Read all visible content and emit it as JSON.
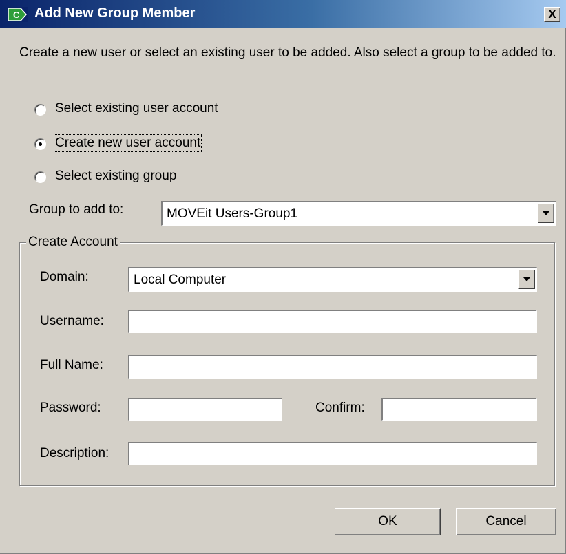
{
  "window": {
    "title": "Add New Group Member",
    "close_label": "X",
    "icon": "app-logo-icon"
  },
  "instruction": "Create a new user or select an existing user to be added. Also select a group to be added to.",
  "options": [
    {
      "label": "Select existing user account",
      "selected": false
    },
    {
      "label": "Create new user account",
      "selected": true
    },
    {
      "label": "Select existing group",
      "selected": false
    }
  ],
  "group_to_add": {
    "label": "Group to add to:",
    "value": "MOVEit Users-Group1"
  },
  "create_account": {
    "legend": "Create Account",
    "domain": {
      "label": "Domain:",
      "value": "Local Computer"
    },
    "username": {
      "label": "Username:",
      "value": ""
    },
    "full_name": {
      "label": "Full Name:",
      "value": ""
    },
    "password": {
      "label": "Password:",
      "value": ""
    },
    "confirm": {
      "label": "Confirm:",
      "value": ""
    },
    "description": {
      "label": "Description:",
      "value": ""
    }
  },
  "buttons": {
    "ok": "OK",
    "cancel": "Cancel"
  },
  "colors": {
    "face": "#d4d0c8",
    "titlebar_start": "#0a246a",
    "titlebar_end": "#a6caf0",
    "icon_green": "#2e9e3a"
  }
}
